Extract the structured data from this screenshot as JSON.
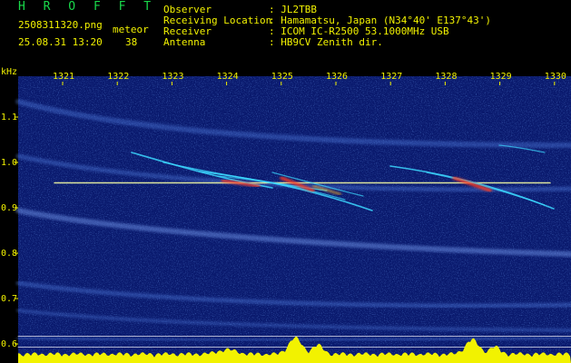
{
  "header": {
    "app_name": "H R O F F T",
    "file_name": "2508311320.png",
    "timestamp": "25.08.31 13:20",
    "mode_label": "meteor",
    "count": "38",
    "info": [
      {
        "label": "Observer",
        "value": ": JL2TBB"
      },
      {
        "label": "Receiving Location",
        "value": ": Hamamatsu, Japan (N34°40' E137°43')"
      },
      {
        "label": "Receiver",
        "value": ": ICOM IC-R2500 53.1000MHz USB"
      },
      {
        "label": "Antenna",
        "value": ": HB9CV Zenith dir."
      }
    ]
  },
  "axis": {
    "unit_label": "kHz",
    "x_ticks": [
      "1321",
      "1322",
      "1323",
      "1324",
      "1325",
      "1326",
      "1327",
      "1328",
      "1329",
      "1330"
    ],
    "y_ticks": [
      "1.1",
      "1.0",
      "0.9",
      "0.8",
      "0.7",
      "0.6"
    ]
  },
  "colors": {
    "header_green": "#19d94a",
    "header_yellow": "#f2f200",
    "background_blue": "#0a1a6e",
    "carrier_line": "#e8f0a0",
    "meteor_red": "#ff3a20",
    "amplitude_yellow": "#f2f200"
  }
}
